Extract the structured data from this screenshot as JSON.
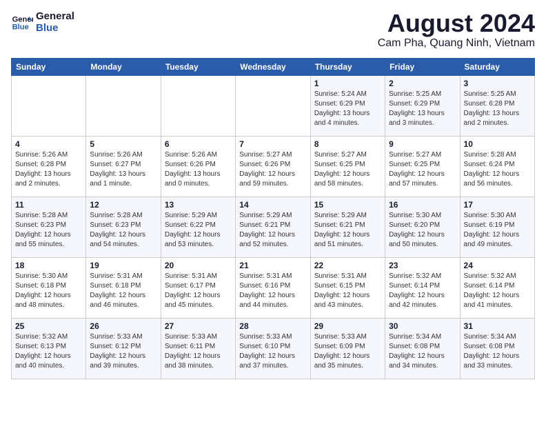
{
  "header": {
    "logo_line1": "General",
    "logo_line2": "Blue",
    "month": "August 2024",
    "location": "Cam Pha, Quang Ninh, Vietnam"
  },
  "weekdays": [
    "Sunday",
    "Monday",
    "Tuesday",
    "Wednesday",
    "Thursday",
    "Friday",
    "Saturday"
  ],
  "weeks": [
    [
      {
        "day": "",
        "info": ""
      },
      {
        "day": "",
        "info": ""
      },
      {
        "day": "",
        "info": ""
      },
      {
        "day": "",
        "info": ""
      },
      {
        "day": "1",
        "info": "Sunrise: 5:24 AM\nSunset: 6:29 PM\nDaylight: 13 hours\nand 4 minutes."
      },
      {
        "day": "2",
        "info": "Sunrise: 5:25 AM\nSunset: 6:29 PM\nDaylight: 13 hours\nand 3 minutes."
      },
      {
        "day": "3",
        "info": "Sunrise: 5:25 AM\nSunset: 6:28 PM\nDaylight: 13 hours\nand 2 minutes."
      }
    ],
    [
      {
        "day": "4",
        "info": "Sunrise: 5:26 AM\nSunset: 6:28 PM\nDaylight: 13 hours\nand 2 minutes."
      },
      {
        "day": "5",
        "info": "Sunrise: 5:26 AM\nSunset: 6:27 PM\nDaylight: 13 hours\nand 1 minute."
      },
      {
        "day": "6",
        "info": "Sunrise: 5:26 AM\nSunset: 6:26 PM\nDaylight: 13 hours\nand 0 minutes."
      },
      {
        "day": "7",
        "info": "Sunrise: 5:27 AM\nSunset: 6:26 PM\nDaylight: 12 hours\nand 59 minutes."
      },
      {
        "day": "8",
        "info": "Sunrise: 5:27 AM\nSunset: 6:25 PM\nDaylight: 12 hours\nand 58 minutes."
      },
      {
        "day": "9",
        "info": "Sunrise: 5:27 AM\nSunset: 6:25 PM\nDaylight: 12 hours\nand 57 minutes."
      },
      {
        "day": "10",
        "info": "Sunrise: 5:28 AM\nSunset: 6:24 PM\nDaylight: 12 hours\nand 56 minutes."
      }
    ],
    [
      {
        "day": "11",
        "info": "Sunrise: 5:28 AM\nSunset: 6:23 PM\nDaylight: 12 hours\nand 55 minutes."
      },
      {
        "day": "12",
        "info": "Sunrise: 5:28 AM\nSunset: 6:23 PM\nDaylight: 12 hours\nand 54 minutes."
      },
      {
        "day": "13",
        "info": "Sunrise: 5:29 AM\nSunset: 6:22 PM\nDaylight: 12 hours\nand 53 minutes."
      },
      {
        "day": "14",
        "info": "Sunrise: 5:29 AM\nSunset: 6:21 PM\nDaylight: 12 hours\nand 52 minutes."
      },
      {
        "day": "15",
        "info": "Sunrise: 5:29 AM\nSunset: 6:21 PM\nDaylight: 12 hours\nand 51 minutes."
      },
      {
        "day": "16",
        "info": "Sunrise: 5:30 AM\nSunset: 6:20 PM\nDaylight: 12 hours\nand 50 minutes."
      },
      {
        "day": "17",
        "info": "Sunrise: 5:30 AM\nSunset: 6:19 PM\nDaylight: 12 hours\nand 49 minutes."
      }
    ],
    [
      {
        "day": "18",
        "info": "Sunrise: 5:30 AM\nSunset: 6:18 PM\nDaylight: 12 hours\nand 48 minutes."
      },
      {
        "day": "19",
        "info": "Sunrise: 5:31 AM\nSunset: 6:18 PM\nDaylight: 12 hours\nand 46 minutes."
      },
      {
        "day": "20",
        "info": "Sunrise: 5:31 AM\nSunset: 6:17 PM\nDaylight: 12 hours\nand 45 minutes."
      },
      {
        "day": "21",
        "info": "Sunrise: 5:31 AM\nSunset: 6:16 PM\nDaylight: 12 hours\nand 44 minutes."
      },
      {
        "day": "22",
        "info": "Sunrise: 5:31 AM\nSunset: 6:15 PM\nDaylight: 12 hours\nand 43 minutes."
      },
      {
        "day": "23",
        "info": "Sunrise: 5:32 AM\nSunset: 6:14 PM\nDaylight: 12 hours\nand 42 minutes."
      },
      {
        "day": "24",
        "info": "Sunrise: 5:32 AM\nSunset: 6:14 PM\nDaylight: 12 hours\nand 41 minutes."
      }
    ],
    [
      {
        "day": "25",
        "info": "Sunrise: 5:32 AM\nSunset: 6:13 PM\nDaylight: 12 hours\nand 40 minutes."
      },
      {
        "day": "26",
        "info": "Sunrise: 5:33 AM\nSunset: 6:12 PM\nDaylight: 12 hours\nand 39 minutes."
      },
      {
        "day": "27",
        "info": "Sunrise: 5:33 AM\nSunset: 6:11 PM\nDaylight: 12 hours\nand 38 minutes."
      },
      {
        "day": "28",
        "info": "Sunrise: 5:33 AM\nSunset: 6:10 PM\nDaylight: 12 hours\nand 37 minutes."
      },
      {
        "day": "29",
        "info": "Sunrise: 5:33 AM\nSunset: 6:09 PM\nDaylight: 12 hours\nand 35 minutes."
      },
      {
        "day": "30",
        "info": "Sunrise: 5:34 AM\nSunset: 6:08 PM\nDaylight: 12 hours\nand 34 minutes."
      },
      {
        "day": "31",
        "info": "Sunrise: 5:34 AM\nSunset: 6:08 PM\nDaylight: 12 hours\nand 33 minutes."
      }
    ]
  ]
}
